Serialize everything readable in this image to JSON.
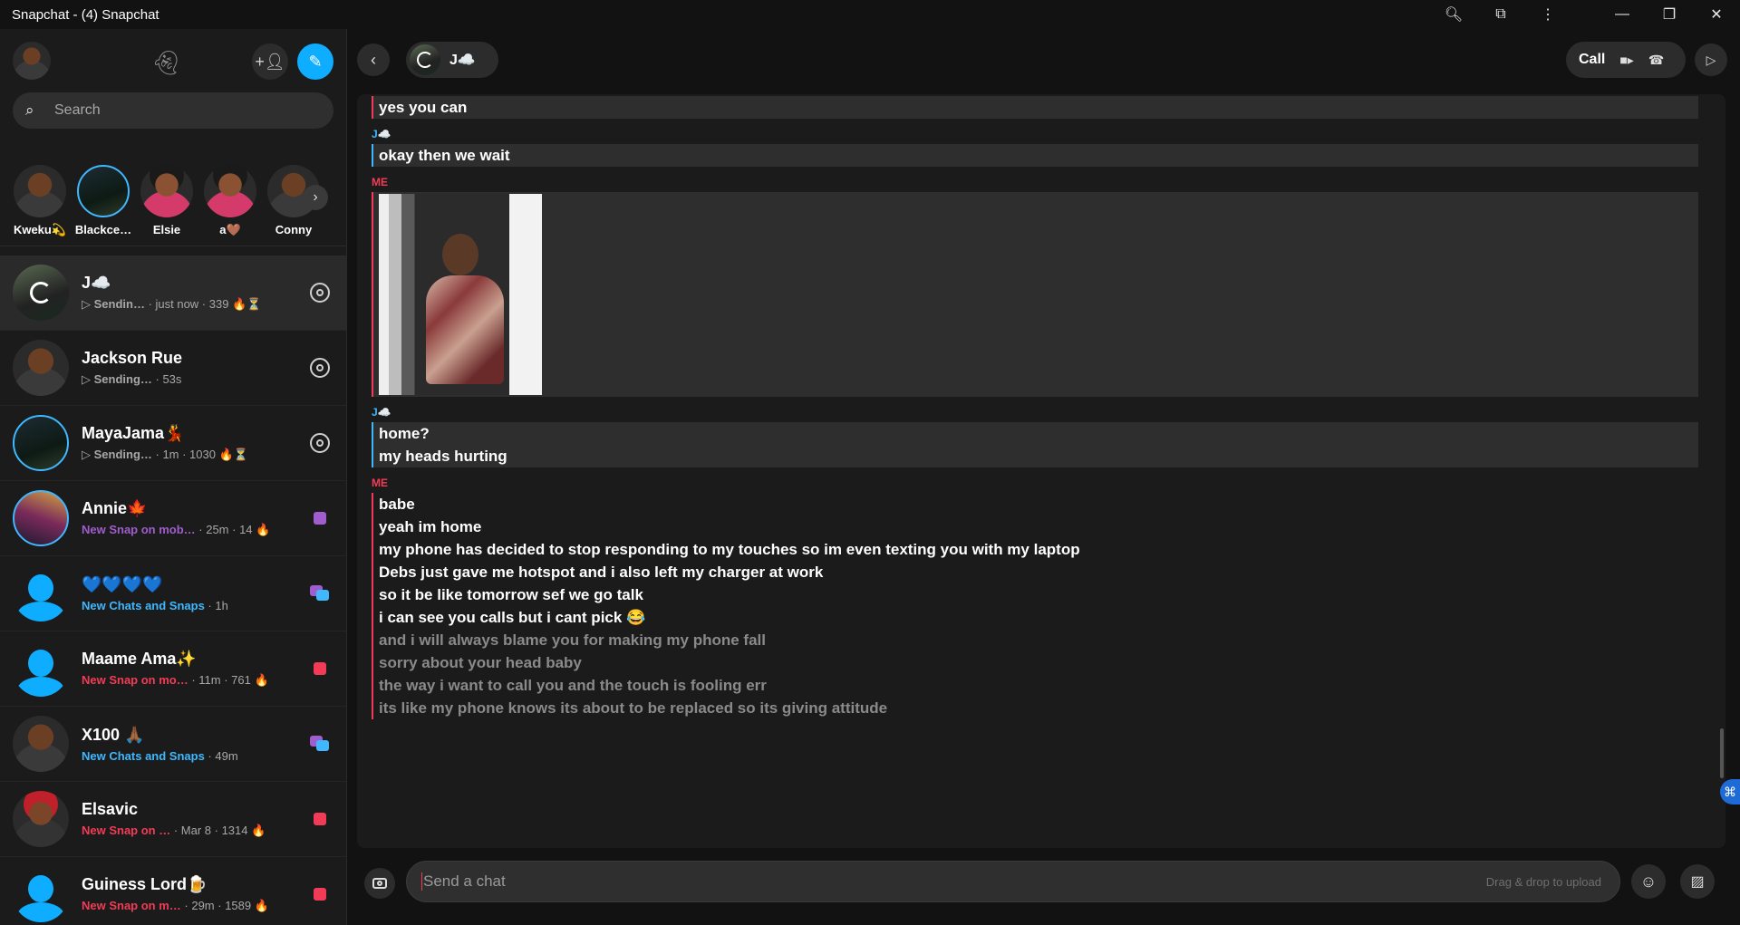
{
  "window": {
    "title": "Snapchat - (4) Snapchat",
    "icons": [
      "zoom-icon",
      "extension-icon",
      "more-icon",
      "minimize-icon",
      "restore-icon",
      "close-icon"
    ]
  },
  "sidebar": {
    "search_placeholder": "Search",
    "stories": [
      {
        "name": "Kweku💫"
      },
      {
        "name": "Blackce…"
      },
      {
        "name": "Elsie"
      },
      {
        "name": "a🤎"
      },
      {
        "name": "Conny"
      }
    ],
    "chats": [
      {
        "name": "J☁️",
        "status": "Sendin…",
        "meta": " · just now · 339 🔥⏳",
        "status_color": "grey",
        "right": "camera"
      },
      {
        "name": "Jackson Rue",
        "status": "Sending…",
        "meta": " · 53s",
        "status_color": "grey",
        "right": "camera"
      },
      {
        "name": "MayaJama💃",
        "status": "Sending…",
        "meta": " · 1m · 1030 🔥⏳",
        "status_color": "grey",
        "right": "camera"
      },
      {
        "name": "Annie🍁",
        "status": "New Snap on mob…",
        "meta": " · 25m · 14 🔥",
        "status_color": "purple",
        "right": "purple-square"
      },
      {
        "name": "💙💙💙💙",
        "status": "New Chats and Snaps",
        "meta": " · 1h",
        "status_color": "blue",
        "right": "chats"
      },
      {
        "name": "Maame Ama✨",
        "status": "New Snap on mo…",
        "meta": " · 11m · 761 🔥",
        "status_color": "red",
        "right": "red-square"
      },
      {
        "name": "X100 🙏🏾",
        "status": "New Chats and Snaps",
        "meta": " · 49m",
        "status_color": "blue",
        "right": "chats"
      },
      {
        "name": "Elsavic",
        "status": "New Snap on …",
        "meta": " · Mar 8 · 1314 🔥",
        "status_color": "red",
        "right": "red-square"
      },
      {
        "name": "Guiness Lord🍺",
        "status": "New Snap on m…",
        "meta": " · 29m · 1589 🔥",
        "status_color": "red",
        "right": "red-square"
      }
    ]
  },
  "chat": {
    "contact_name": "J☁️",
    "call_label": "Call",
    "me_label": "ME",
    "them_label": "J☁️",
    "msg_top": "yes you can",
    "msg_wait": "okay then we wait",
    "msg_home": "home?",
    "msg_head": "my heads hurting",
    "me_messages": [
      "babe",
      "yeah im home",
      "my phone has decided to stop responding to my touches so im even texting you with my laptop",
      "Debs just gave me hotspot and i also left my charger at work",
      "so it be like tomorrow sef we go talk",
      "i can see you calls but i cant pick 😂"
    ],
    "me_pending": [
      "and i will always blame you for making  my phone fall",
      "sorry about your head baby",
      "the way i want to call you and the touch is fooling err",
      "its like my phone knows its about to be replaced so its giving attitude"
    ],
    "composer_placeholder": "Send a chat",
    "drag_drop": "Drag & drop to upload"
  }
}
